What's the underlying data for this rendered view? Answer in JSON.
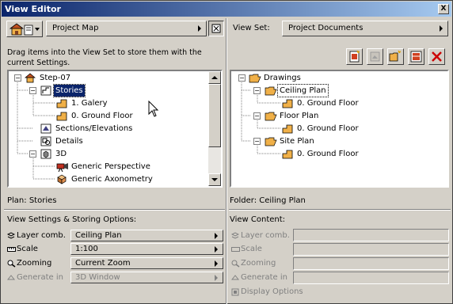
{
  "window": {
    "title": "View Editor",
    "close_glyph": "X"
  },
  "left": {
    "map_selector": "Project Map",
    "instructions": "Drag items into the View Set to store them with the current Settings.",
    "tree": [
      {
        "label": "Step-07"
      },
      {
        "label": "Stories"
      },
      {
        "label": "1. Galery"
      },
      {
        "label": "0. Ground Floor"
      },
      {
        "label": "Sections/Elevations"
      },
      {
        "label": "Details"
      },
      {
        "label": "3D"
      },
      {
        "label": "Generic Perspective"
      },
      {
        "label": "Generic Axonometry"
      }
    ],
    "status": "Plan: Stories",
    "settings_title": "View Settings & Storing Options:",
    "options": [
      {
        "label": "Layer comb.",
        "value": "Ceiling Plan",
        "icon": "layer-icon"
      },
      {
        "label": "Scale",
        "value": "1:100",
        "icon": "scale-icon"
      },
      {
        "label": "Zooming",
        "value": "Current Zoom",
        "icon": "zoom-icon"
      },
      {
        "label": "Generate in",
        "value": "3D Window",
        "icon": "generate-icon"
      }
    ]
  },
  "right": {
    "viewset_label": "View Set:",
    "viewset_selector": "Project Documents",
    "tree": [
      {
        "label": "Drawings"
      },
      {
        "label": "Ceiling Plan"
      },
      {
        "label": "0. Ground Floor"
      },
      {
        "label": "Floor Plan"
      },
      {
        "label": "0. Ground Floor"
      },
      {
        "label": "Site Plan"
      },
      {
        "label": "0. Ground Floor"
      }
    ],
    "status": "Folder: Ceiling Plan",
    "content_title": "View Content:",
    "options": [
      {
        "label": "Layer comb."
      },
      {
        "label": "Scale"
      },
      {
        "label": "Zooming"
      },
      {
        "label": "Generate in"
      },
      {
        "label": "Display Options"
      }
    ]
  },
  "colors": {
    "title_start": "#0a246a",
    "title_end": "#a6caf0",
    "folder": "#f0b048",
    "selection": "#0a246a",
    "delete": "#cc0000"
  }
}
